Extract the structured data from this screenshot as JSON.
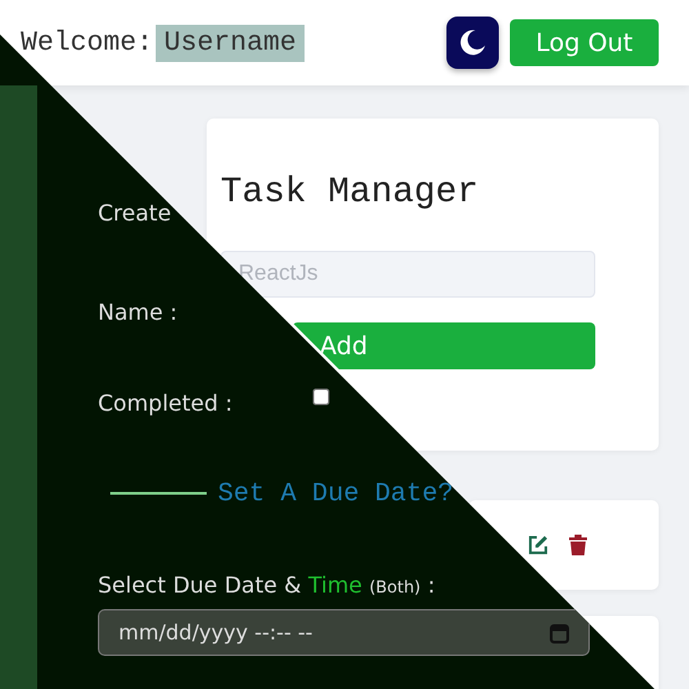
{
  "header": {
    "welcome_label": "Welcome:",
    "username": "Username",
    "logout_button": "Log Out"
  },
  "task_form": {
    "title": "Task Manager",
    "created_label": "Create",
    "name_label": "Name :",
    "name_placeholder": "ReactJs",
    "add_button": "Add",
    "completed_label": "Completed :",
    "completed": false
  },
  "due_date": {
    "heading": "Set A Due Date?",
    "label": "Select Due Date & ",
    "accent": "Time",
    "note": "(Both)",
    "suffix": " :",
    "placeholder": "mm/dd/yyyy --:-- --"
  }
}
